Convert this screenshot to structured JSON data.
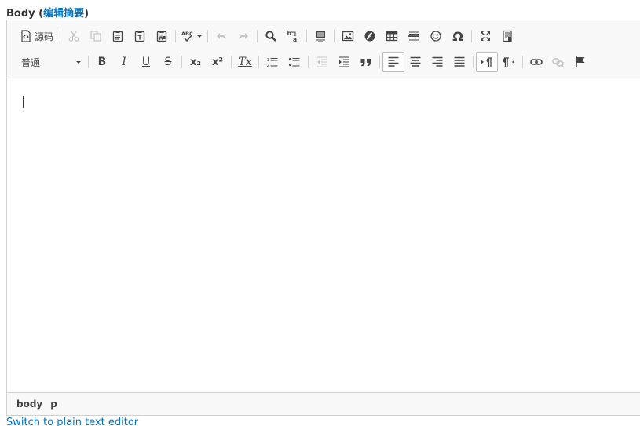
{
  "field": {
    "label": "Body",
    "summary_link": "编辑摘要"
  },
  "toolbar": {
    "source_label": "源码",
    "format_selected": "普通",
    "spellcheck_icon_text": "ABC",
    "special_char": "Ω",
    "bold": "B",
    "italic": "I",
    "underline": "U",
    "strike": "S",
    "subscript": "x₂",
    "superscript": "x²",
    "remove_format": "Tx"
  },
  "pathbar": {
    "items": [
      "body",
      "p"
    ]
  },
  "switch_link": "Switch to plain text editor"
}
